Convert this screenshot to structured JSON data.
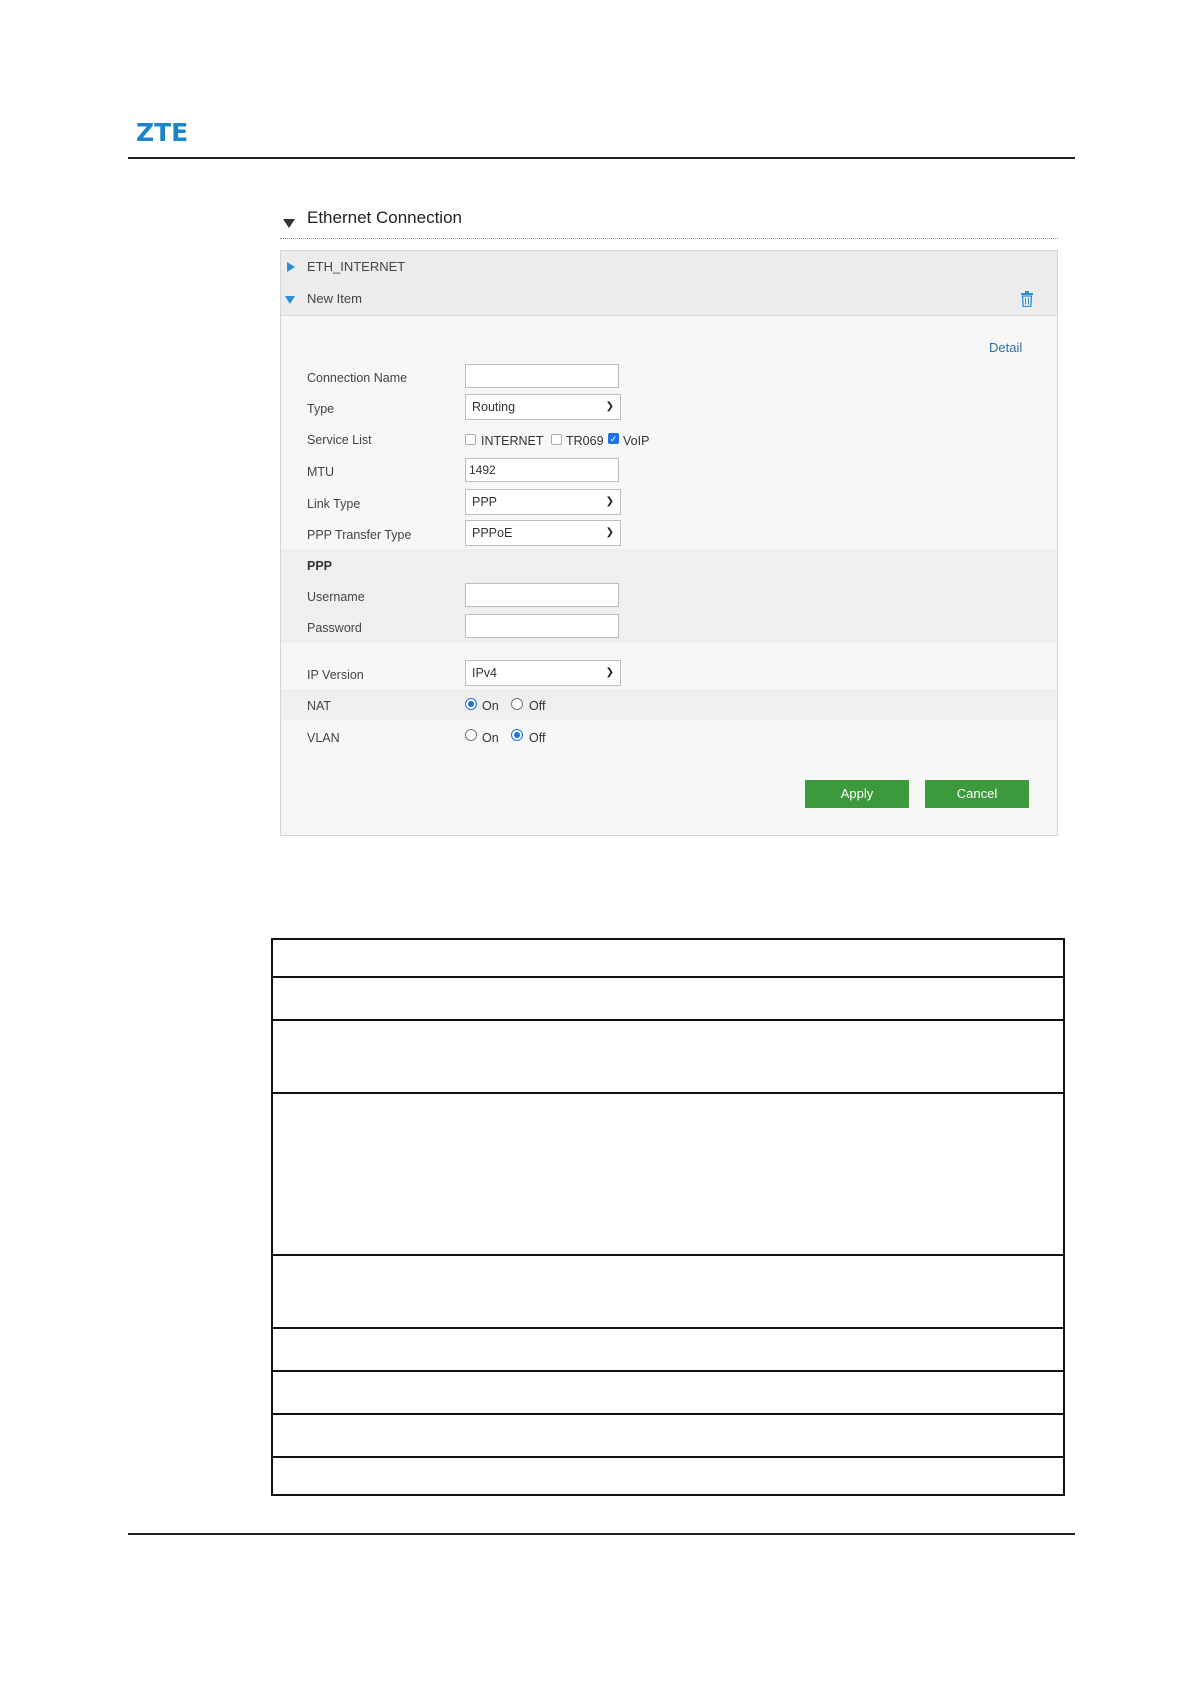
{
  "logo": "ZTE",
  "section": {
    "title": "Ethernet Connection"
  },
  "items": [
    {
      "label": "ETH_INTERNET",
      "expanded": false
    },
    {
      "label": "New Item",
      "expanded": true
    }
  ],
  "detail_link": "Detail",
  "form": {
    "connection_name": {
      "label": "Connection Name",
      "value": ""
    },
    "type": {
      "label": "Type",
      "value": "Routing"
    },
    "service_list": {
      "label": "Service List",
      "options": [
        {
          "label": "INTERNET",
          "checked": false
        },
        {
          "label": "TR069",
          "checked": false
        },
        {
          "label": "VoIP",
          "checked": true
        }
      ]
    },
    "mtu": {
      "label": "MTU",
      "value": "1492"
    },
    "link_type": {
      "label": "Link Type",
      "value": "PPP"
    },
    "ppp_transfer_type": {
      "label": "PPP Transfer Type",
      "value": "PPPoE"
    },
    "ppp_heading": "PPP",
    "username": {
      "label": "Username",
      "value": ""
    },
    "password": {
      "label": "Password",
      "value": ""
    },
    "ip_version": {
      "label": "IP Version",
      "value": "IPv4"
    },
    "nat": {
      "label": "NAT",
      "on_label": "On",
      "off_label": "Off",
      "selected": "On"
    },
    "vlan": {
      "label": "VLAN",
      "on_label": "On",
      "off_label": "Off",
      "selected": "Off"
    }
  },
  "buttons": {
    "apply": "Apply",
    "cancel": "Cancel"
  },
  "table": {
    "rows": 9
  },
  "colors": {
    "brand": "#1a86c8",
    "button": "#3c9a3c",
    "accent": "#2a8fd6"
  }
}
